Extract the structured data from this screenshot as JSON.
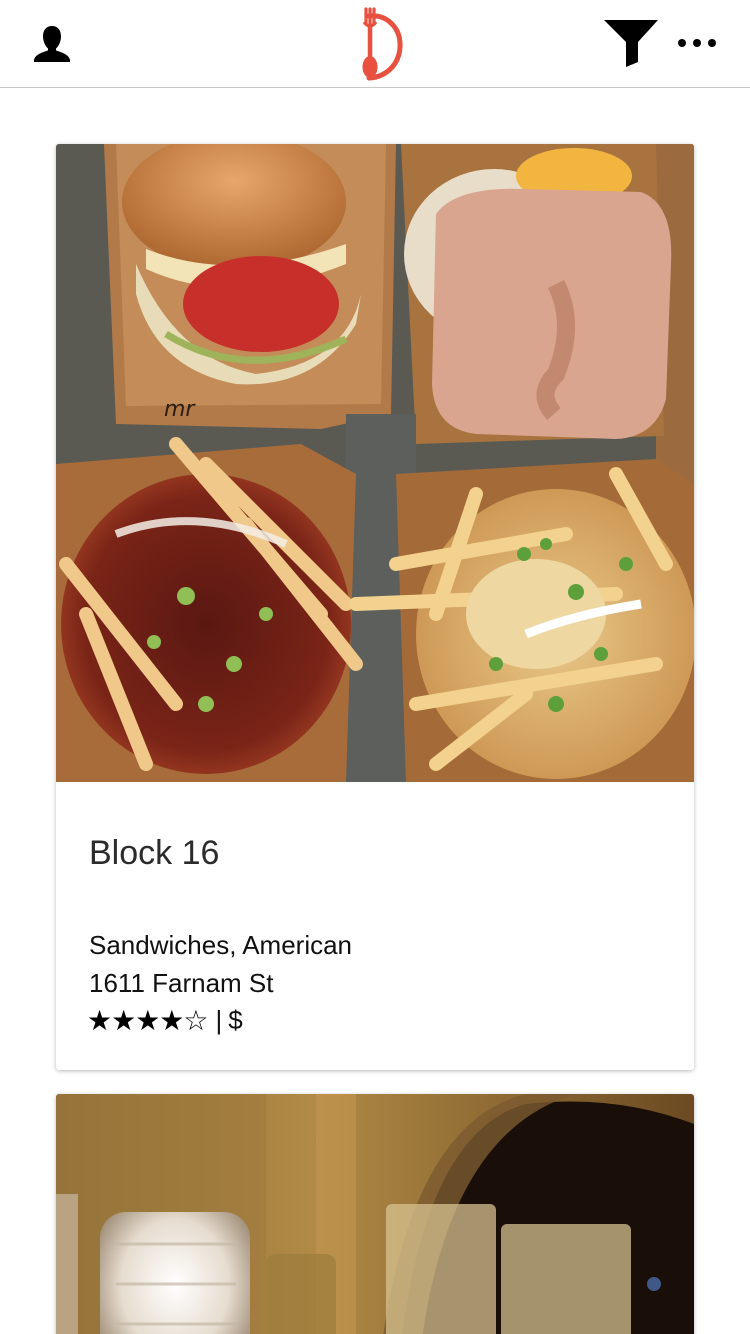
{
  "header": {
    "profile_icon": "person-icon",
    "logo_icon": "fork-spoon-d-logo",
    "filter_icon": "funnel-icon",
    "more_icon": "ellipsis-icon",
    "logo_color": "#e8503f"
  },
  "restaurants": [
    {
      "name": "Block 16",
      "categories": "Sandwiches, American",
      "address": "1611 Farnam St",
      "rating_stars": "★★★★☆",
      "rating": 4.5,
      "separator": "|",
      "price": "$"
    }
  ]
}
